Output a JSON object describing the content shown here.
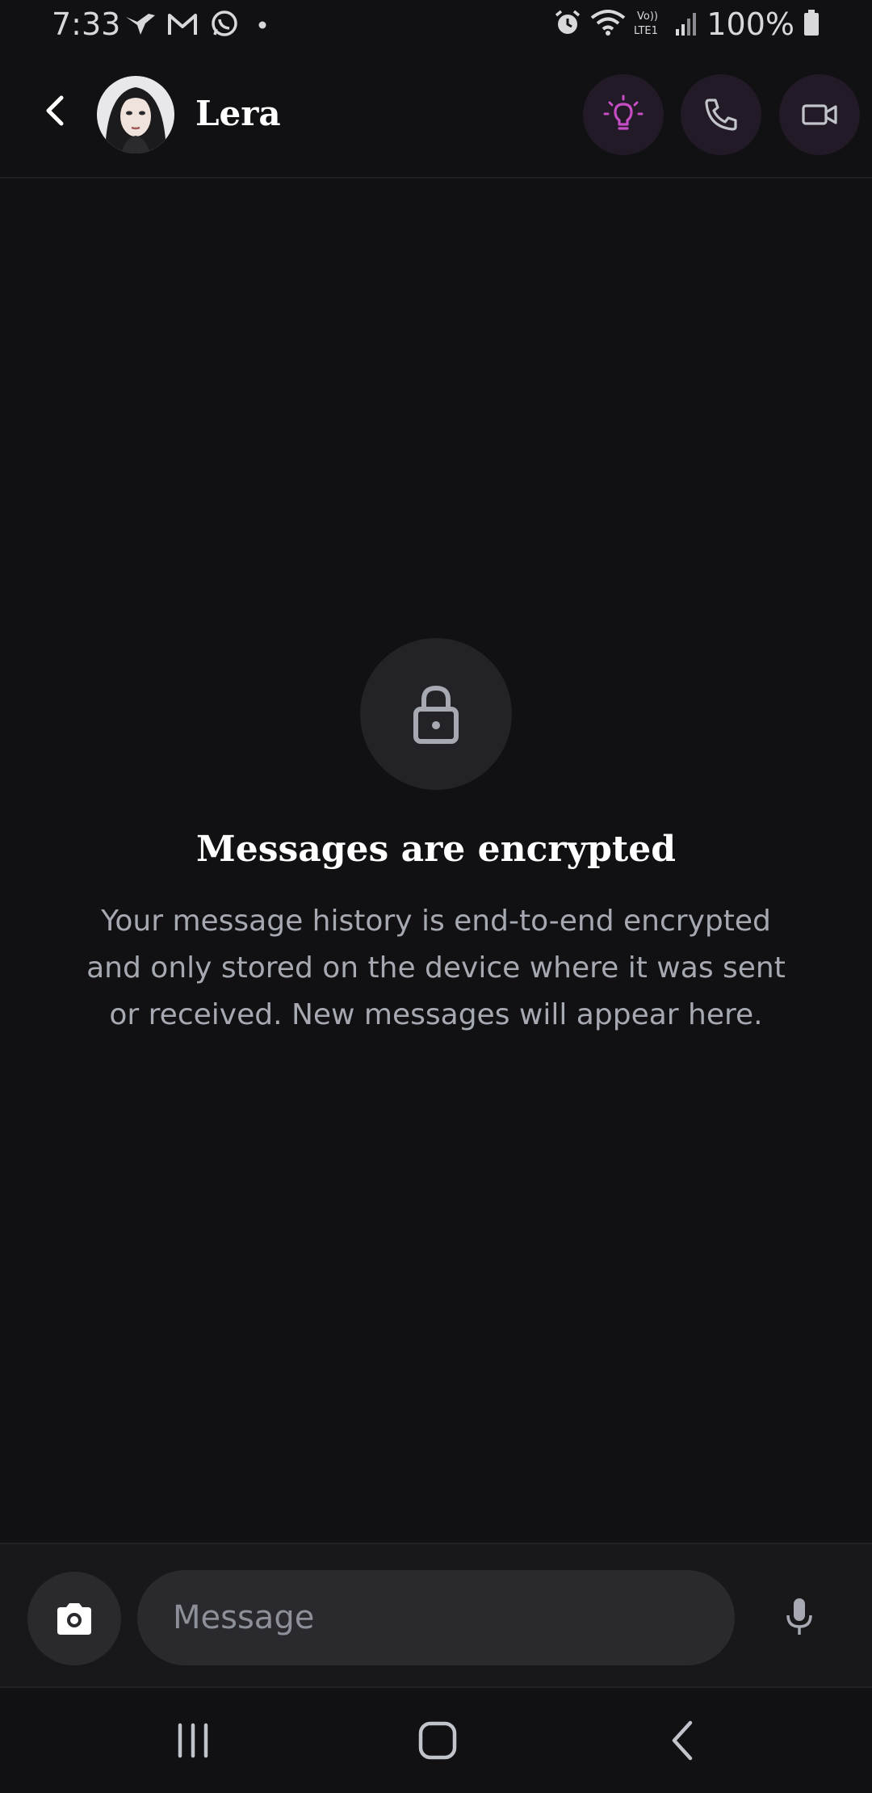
{
  "status_bar": {
    "time": "7:33",
    "battery": "100%",
    "left_icons": [
      "bird-notification-icon",
      "gmail-icon",
      "whatsapp-icon",
      "dot-icon"
    ],
    "right_icons": [
      "alarm-icon",
      "wifi-icon",
      "volte-lte-icon",
      "signal-icon",
      "battery-icon"
    ],
    "volte_label": "Vo)) LTE1"
  },
  "header": {
    "contact_name": "Lera",
    "actions": [
      "lightbulb-icon",
      "phone-icon",
      "video-camera-icon"
    ],
    "accent_color": "#c64ec4"
  },
  "empty_state": {
    "title": "Messages are encrypted",
    "body": "Your message history is end-to-end encrypted and only stored on the device where it was sent or received. New messages will appear here."
  },
  "composer": {
    "placeholder": "Message",
    "value": ""
  },
  "navigation": {
    "buttons": [
      "recents-icon",
      "home-icon",
      "back-icon"
    ]
  }
}
